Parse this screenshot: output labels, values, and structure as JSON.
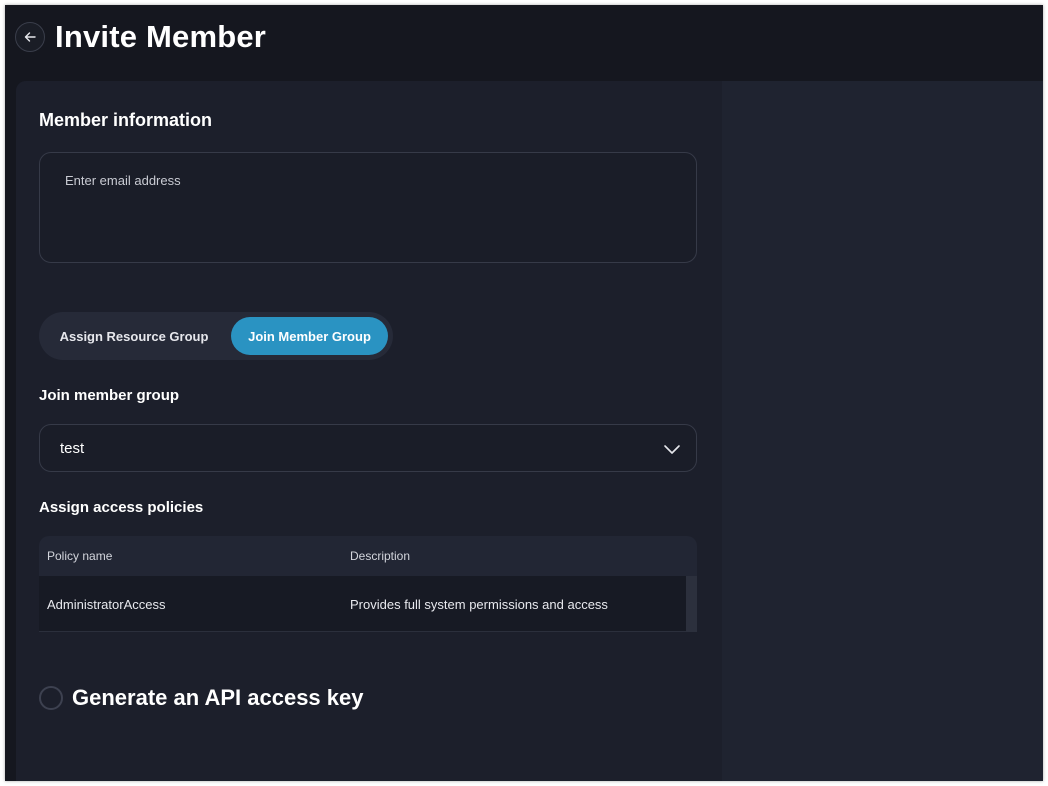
{
  "header": {
    "title": "Invite Member",
    "back_icon": "arrow-left-icon"
  },
  "member_info": {
    "section_title": "Member information",
    "email_placeholder": "Enter email address",
    "email_value": ""
  },
  "assignment_toggle": {
    "options": [
      "Assign Resource Group",
      "Join Member Group"
    ],
    "selected": "Join Member Group",
    "accent_color": "#2a93c2"
  },
  "member_group": {
    "label": "Join member group",
    "selected_value": "test",
    "chevron_icon": "chevron-down-icon"
  },
  "access_policies": {
    "label": "Assign access policies",
    "columns": [
      "Policy name",
      "Description"
    ],
    "rows": [
      {
        "name": "AdministratorAccess",
        "description": "Provides full system permissions and access"
      }
    ]
  },
  "api_key": {
    "label": "Generate an API access key",
    "checked": false
  }
}
